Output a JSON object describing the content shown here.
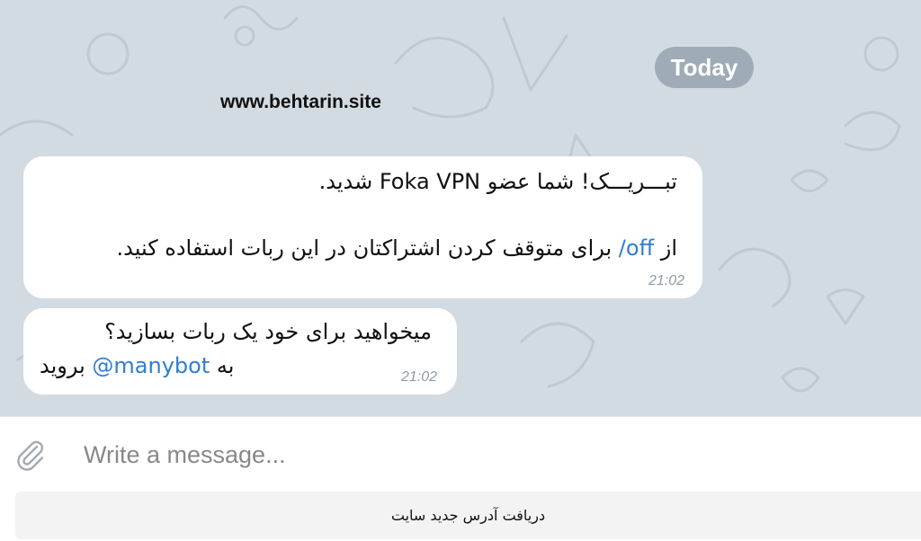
{
  "chat": {
    "date_label": "Today",
    "watermark": "www.behtarin.site",
    "messages": [
      {
        "line1": "تبـــریـــک! شما عضو Foka VPN شدید.",
        "line2_prefix": "از ",
        "line2_command": "/off",
        "line2_suffix": " برای متوقف کردن اشتراکتان در این ربات استفاده کنید.",
        "time": "21:02"
      },
      {
        "line1": "میخواهید برای خود یک ربات بسازید؟",
        "line2_prefix": "به ",
        "line2_mention": "@manybot",
        "line2_suffix": " بروید",
        "time": "21:02"
      }
    ]
  },
  "composer": {
    "placeholder": "Write a message..."
  },
  "keyboard": {
    "button_label": "دریافت آدرس جدید سایت"
  },
  "icons": {
    "attach": "paperclip-icon"
  },
  "colors": {
    "chat_background": "#d3dbe2",
    "date_pill": "#9fabb6",
    "link": "#2e7ed3",
    "timestamp": "#8e9aa5"
  }
}
